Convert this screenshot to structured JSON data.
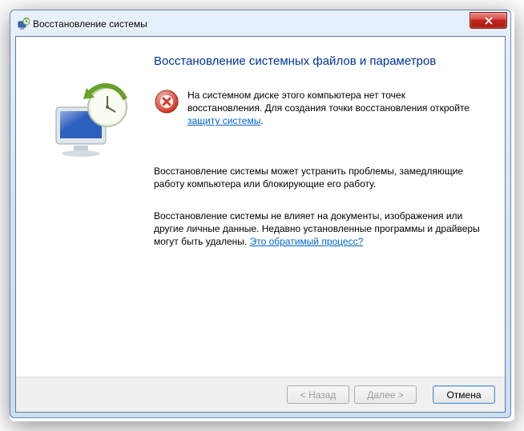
{
  "window": {
    "title": "Восстановление системы"
  },
  "heading": "Восстановление системных файлов и параметров",
  "alert": {
    "line1": "На системном диске этого компьютера нет точек восстановления. Для создания точки восстановления откройте ",
    "link": "защиту системы",
    "tail": "."
  },
  "para1": "Восстановление системы может устранить проблемы, замедляющие работу компьютера или блокирующие его работу.",
  "para2": {
    "text": "Восстановление системы не влияет на документы, изображения или другие личные данные. Недавно установленные программы и драйверы могут быть удалены. ",
    "link": "Это обратимый процесс?"
  },
  "buttons": {
    "back": "< Назад",
    "next": "Далее >",
    "cancel": "Отмена"
  }
}
